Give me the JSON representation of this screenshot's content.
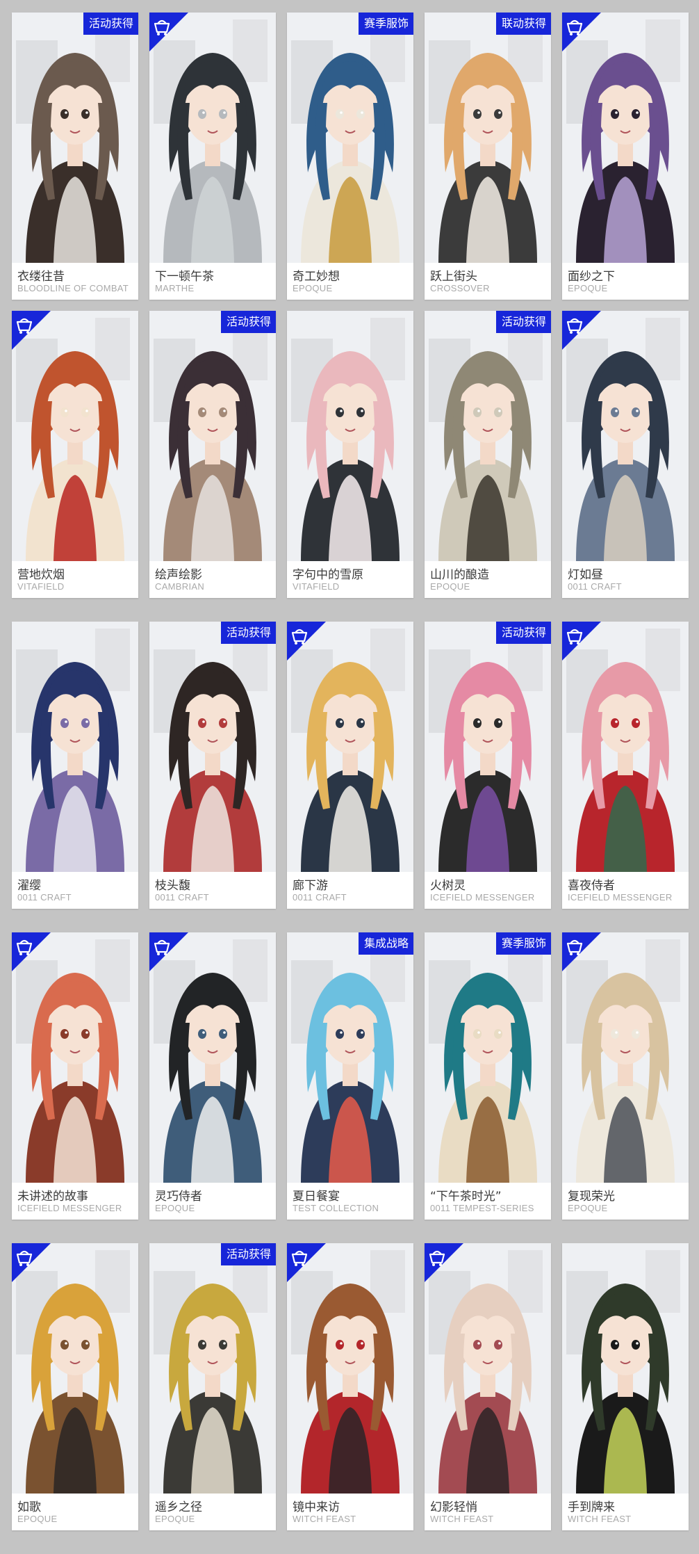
{
  "colors": {
    "background": "#c4c4c4",
    "card": "#ffffff",
    "tag": "#1726d9",
    "name_text": "#3a3a3a",
    "brand_text": "#a9a9a9"
  },
  "icons": {
    "corner": "shop-bag-icon"
  },
  "cards": [
    {
      "name": "衣缕往昔",
      "brand": "BLOODLINE OF COMBAT",
      "tag": "活动获得",
      "corner": false,
      "palette": [
        "#6b5a4e",
        "#e9e4df",
        "#3a2f2a"
      ]
    },
    {
      "name": "下一顿午茶",
      "brand": "MARTHE",
      "tag": "",
      "corner": true,
      "palette": [
        "#2e3338",
        "#cfd3d6",
        "#b5b9bd"
      ]
    },
    {
      "name": "奇工妙想",
      "brand": "EPOQUE",
      "tag": "赛季服饰",
      "corner": false,
      "palette": [
        "#2f5d8a",
        "#c89a3c",
        "#ece7dc"
      ]
    },
    {
      "name": "跃上街头",
      "brand": "CROSSOVER",
      "tag": "联动获得",
      "corner": false,
      "palette": [
        "#e0a86b",
        "#f4efe6",
        "#3b3b3b"
      ]
    },
    {
      "name": "面纱之下",
      "brand": "EPOQUE",
      "tag": "",
      "corner": true,
      "palette": [
        "#6a4f8f",
        "#b7a3d6",
        "#2a2230"
      ]
    },
    {
      "name": "营地炊烟",
      "brand": "VITAFIELD",
      "tag": "",
      "corner": true,
      "palette": [
        "#c0542e",
        "#b9251f",
        "#f2e3cf"
      ]
    },
    {
      "name": "绘声绘影",
      "brand": "CAMBRIAN",
      "tag": "活动获得",
      "corner": false,
      "palette": [
        "#3b2f36",
        "#e6e1de",
        "#a48a78"
      ]
    },
    {
      "name": "字句中的雪原",
      "brand": "VITAFIELD",
      "tag": "",
      "corner": false,
      "palette": [
        "#eab8bd",
        "#f7eef0",
        "#2f3338"
      ]
    },
    {
      "name": "山川的酿造",
      "brand": "EPOQUE",
      "tag": "活动获得",
      "corner": false,
      "palette": [
        "#8f8875",
        "#3a352c",
        "#cfc9b9"
      ]
    },
    {
      "name": "灯如昼",
      "brand": "0011 CRAFT",
      "tag": "",
      "corner": true,
      "palette": [
        "#2f3a4a",
        "#d8cfbf",
        "#6b7b93"
      ]
    },
    {
      "name": "濯缨",
      "brand": "0011 CRAFT",
      "tag": "",
      "corner": false,
      "palette": [
        "#27356b",
        "#e8e6ee",
        "#7a6ba6"
      ]
    },
    {
      "name": "枝头馥",
      "brand": "0011 CRAFT",
      "tag": "活动获得",
      "corner": false,
      "palette": [
        "#2e2624",
        "#efe8e2",
        "#b23c3c"
      ]
    },
    {
      "name": "廊下游",
      "brand": "0011 CRAFT",
      "tag": "",
      "corner": true,
      "palette": [
        "#e3b45c",
        "#f3f0ea",
        "#2a3646"
      ]
    },
    {
      "name": "火树灵",
      "brand": "ICEFIELD MESSENGER",
      "tag": "活动获得",
      "corner": false,
      "palette": [
        "#e58aa4",
        "#7a4fa3",
        "#2b2b2b"
      ]
    },
    {
      "name": "喜夜侍者",
      "brand": "ICEFIELD MESSENGER",
      "tag": "",
      "corner": true,
      "palette": [
        "#e79aa7",
        "#2f6b4d",
        "#b8252c"
      ]
    },
    {
      "name": "未讲述的故事",
      "brand": "ICEFIELD MESSENGER",
      "tag": "",
      "corner": true,
      "palette": [
        "#d96b4e",
        "#f3e4d6",
        "#8a3b2a"
      ]
    },
    {
      "name": "灵巧侍者",
      "brand": "EPOQUE",
      "tag": "",
      "corner": true,
      "palette": [
        "#222426",
        "#f0f0f0",
        "#3f5d7a"
      ]
    },
    {
      "name": "夏日餐宴",
      "brand": "TEST COLLECTION",
      "tag": "集成战略",
      "corner": false,
      "palette": [
        "#6cc0e0",
        "#e85a4a",
        "#2d3c5a"
      ]
    },
    {
      "name": "“下午茶时光”",
      "brand": "0011 TEMPEST-SERIES",
      "tag": "赛季服饰",
      "corner": false,
      "palette": [
        "#1f7a86",
        "#8a5a2e",
        "#e9dcc4"
      ]
    },
    {
      "name": "复现荣光",
      "brand": "EPOQUE",
      "tag": "",
      "corner": true,
      "palette": [
        "#d8c3a0",
        "#4a4f57",
        "#eee8dc"
      ]
    },
    {
      "name": "如歌",
      "brand": "EPOQUE",
      "tag": "",
      "corner": true,
      "palette": [
        "#d9a23a",
        "#2a2624",
        "#7a5230"
      ]
    },
    {
      "name": "遥乡之径",
      "brand": "EPOQUE",
      "tag": "活动获得",
      "corner": false,
      "palette": [
        "#c8a83e",
        "#e7e0d0",
        "#3b3a36"
      ]
    },
    {
      "name": "镜中来访",
      "brand": "WITCH FEAST",
      "tag": "",
      "corner": true,
      "palette": [
        "#9a5a32",
        "#2a2428",
        "#b3262b"
      ]
    },
    {
      "name": "幻影轻悄",
      "brand": "WITCH FEAST",
      "tag": "",
      "corner": true,
      "palette": [
        "#e6cfc0",
        "#2b2326",
        "#a34b52"
      ]
    },
    {
      "name": "手到牌来",
      "brand": "WITCH FEAST",
      "tag": "",
      "corner": false,
      "palette": [
        "#2f3a2a",
        "#c6d55a",
        "#1a1a1a"
      ]
    }
  ]
}
